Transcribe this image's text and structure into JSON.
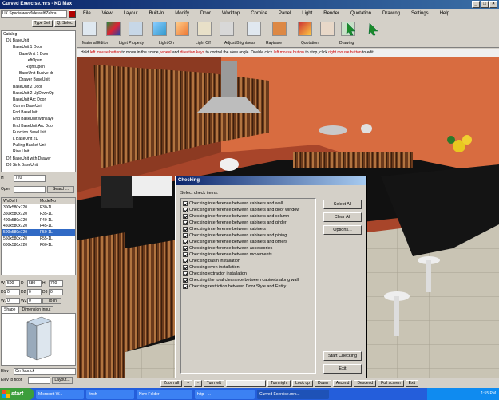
{
  "app": {
    "title": "Curved Exercise.mrs - KD Max"
  },
  "left": {
    "select_path": "UK Specialwood\\default\\Zebra",
    "type_sel": "Type Sel.",
    "q_select": "Q. Select",
    "tree": [
      "Catalog",
      "D1 BaseUnit",
      "BaseUnit 1 Door",
      "BaseUnit 1 Door",
      "LeftOpen",
      "RightOpen",
      "BaseUnit Busive dr",
      "Drawer BaseUnit",
      "BaseUnit 2 Door",
      "BaseUnit 2 UpDownOp",
      "BaseUnit Arc Door",
      "Corner BaseUnit",
      "End BaseUnit",
      "End BaseUnit with laye",
      "End BaseUnit Arc Door",
      "Function BaseUnit",
      "L BaseUnit 2D",
      "Pulling Basket Unit",
      "Rice Unit",
      "D2 BaseUnit with Drawer",
      "D3 Sink BaseUnit"
    ],
    "h_label": "H",
    "h_value": "720",
    "open_label": "Open",
    "search_label": "Search...",
    "model_headers": [
      "WxDxH",
      "ModelNo"
    ],
    "models": [
      [
        "300x580x720",
        "F30-1L"
      ],
      [
        "350x580x720",
        "F35-1L"
      ],
      [
        "400x580x720",
        "F40-1L"
      ],
      [
        "450x580x720",
        "F45-1L"
      ],
      [
        "500x580x720",
        "F50-1L"
      ],
      [
        "550x580x720",
        "F55-1L"
      ],
      [
        "600x580x720",
        "F60-1L"
      ]
    ],
    "dims": {
      "W": "500",
      "D": "580",
      "H": "720",
      "D1": "0",
      "D2": "0",
      "D3": "0",
      "W1": "0",
      "W2": "0",
      "W3": "0",
      "to_in": "To In"
    },
    "tabs": [
      "Shape",
      "Dimension input"
    ],
    "elev_label": "Elev",
    "elev_value": "On floor/ck",
    "elev_to_floor": "Elev to floor",
    "layout_btn": "Layout..."
  },
  "menu": [
    "File",
    "View",
    "Layout",
    "Built-In",
    "Modify",
    "Door",
    "Worktop",
    "Cornice",
    "Panel",
    "Light",
    "Render",
    "Quotation",
    "Drawing",
    "Settings",
    "Help"
  ],
  "toolbar_groups": [
    "Material Editor",
    "Light Property",
    "Light On",
    "Light Off",
    "Adjust Brightness",
    "Raytrace",
    "Quotation",
    "Drawing"
  ],
  "hint": {
    "p1": "Hold ",
    "r1": "left mouse button",
    "p2": " to move in the scene, ",
    "r2": "wheel",
    "p3": " and ",
    "r3": "direction keys",
    "p4": " to control the view angle. Double click ",
    "r4": "left mouse button",
    "p5": " to stop, click ",
    "r5": "right mouse button",
    "p6": " to edit"
  },
  "dialog": {
    "title": "Checking",
    "label": "Select check items:",
    "items": [
      "Checking interference between cabinets and wall",
      "Checking interference between cabinets and door window",
      "Checking interference between cabinets and column",
      "Checking interference between cabinets and girder",
      "Checking interference between cabinets",
      "Checking interference between cabinets and piping",
      "Checking interference between cabinets and others",
      "Checking interference between accessories",
      "Checking interference between movements",
      "Checking basin installation",
      "Checking oven installation",
      "Checking extractor installation",
      "Checking the total clearance between cabinets along wall",
      "Checking restriction between Door Style and Entity"
    ],
    "select_all": "Select All",
    "clear_all": "Clear All",
    "options": "Options...",
    "start_checking": "Start Checking",
    "exit": "Exit"
  },
  "status": [
    "Zoom all",
    "+",
    "-",
    "Turn left",
    "Turn right",
    "Look up",
    "Down",
    "Ascend",
    "Descend",
    "Full screen",
    "Exit"
  ],
  "taskbar": {
    "start": "start",
    "tasks": [
      "Microsoft W...",
      "finsh",
      "New Folder",
      "http - ...",
      "Curved Exercise.mrs..."
    ],
    "clock": "1:55 PM"
  }
}
